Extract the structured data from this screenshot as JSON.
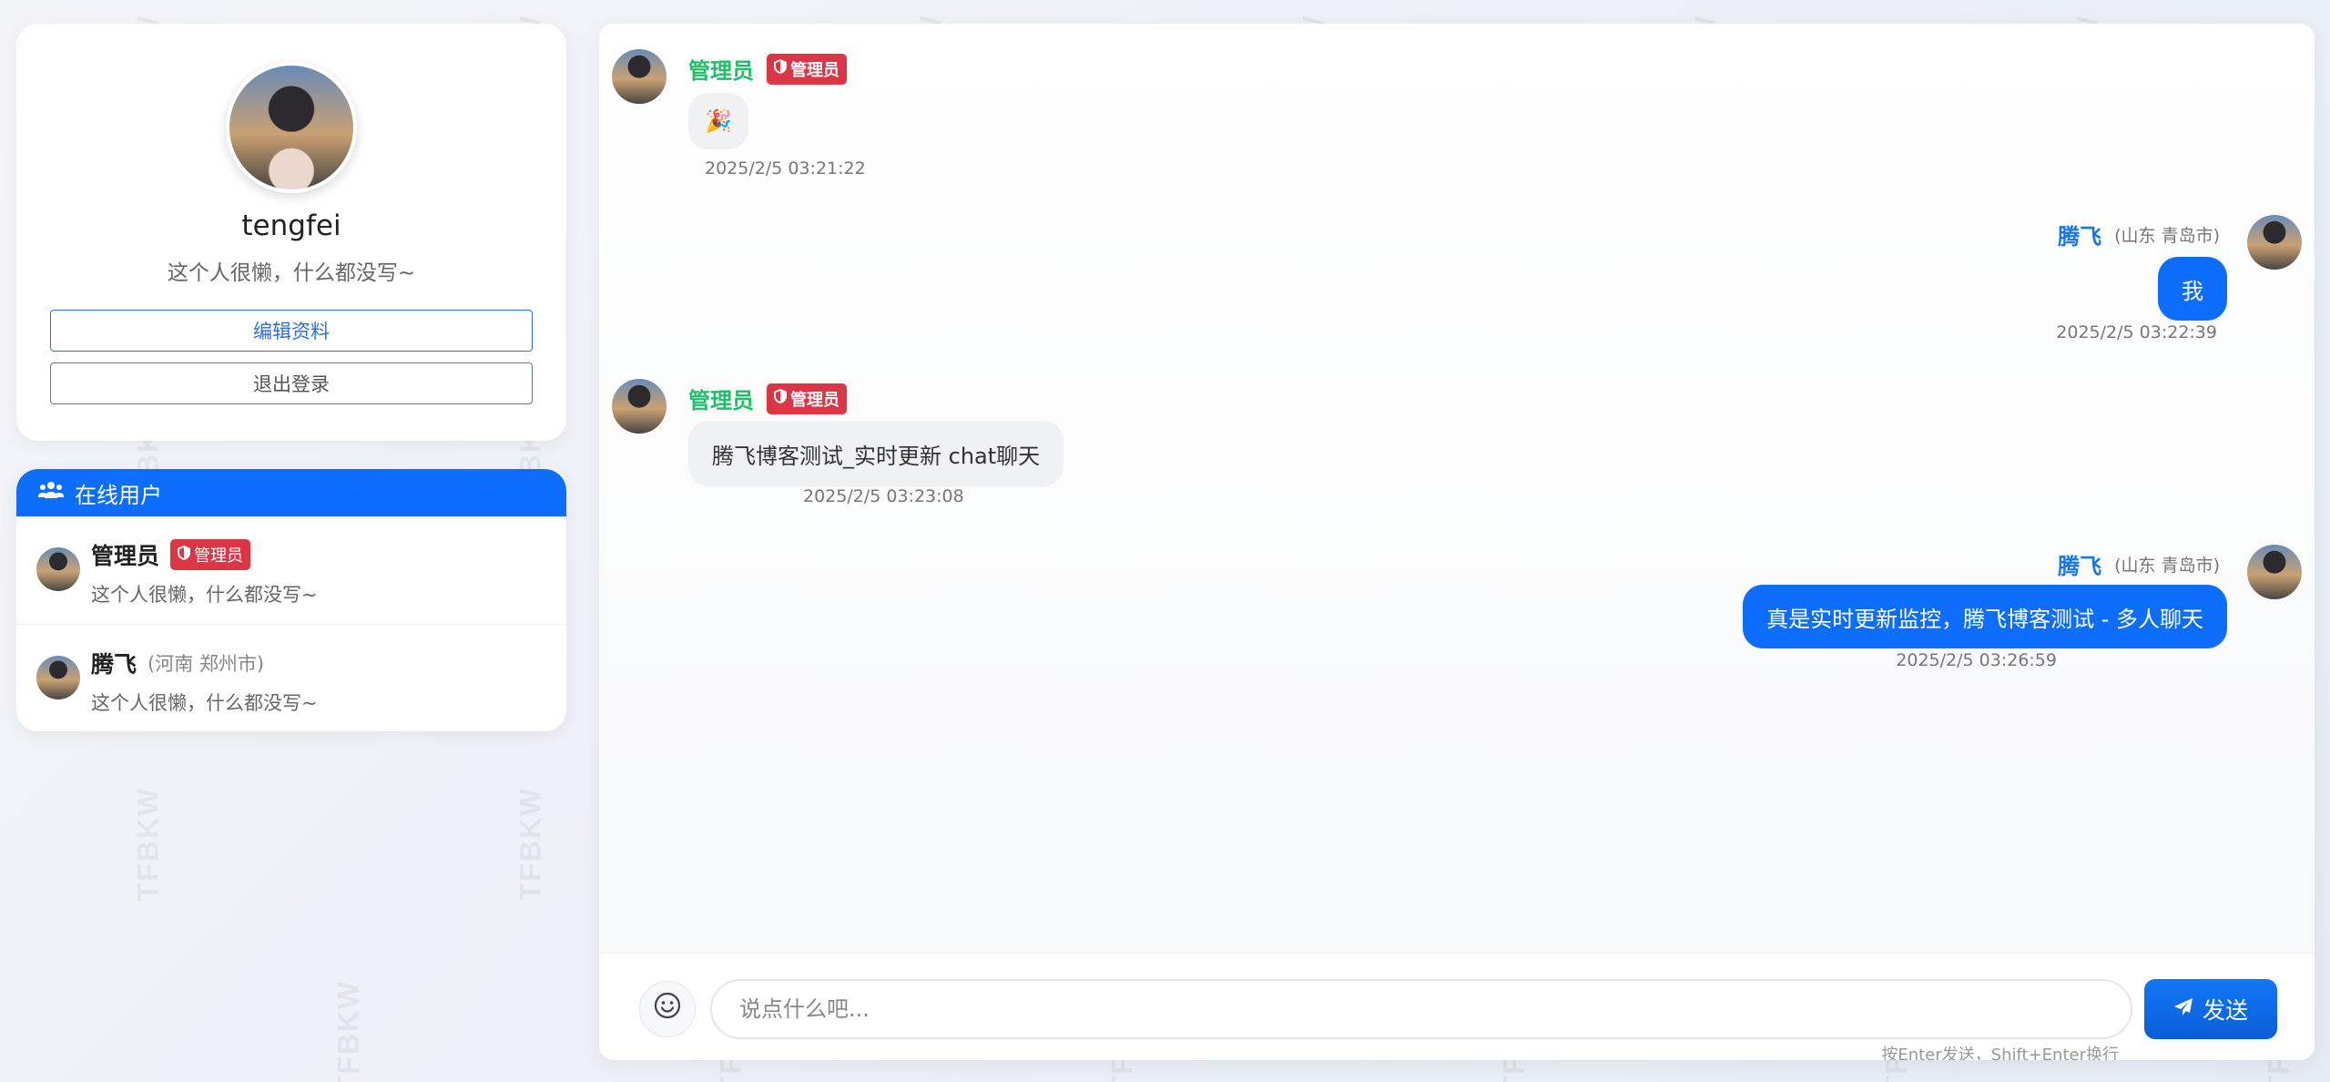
{
  "watermark_text": "TFBKW",
  "profile": {
    "name": "tengfei",
    "signature": "这个人很懒，什么都没写~",
    "edit_label": "编辑资料",
    "logout_label": "退出登录"
  },
  "online": {
    "title": "在线用户",
    "users": [
      {
        "name": "管理员",
        "badge": "管理员",
        "location": "",
        "signature": "这个人很懒，什么都没写~"
      },
      {
        "name": "腾飞",
        "badge": "",
        "location": "(河南 郑州市)",
        "signature": "这个人很懒，什么都没写~"
      }
    ]
  },
  "messages": [
    {
      "side": "left",
      "sender": "管理员",
      "badge": "管理员",
      "text": "🎉",
      "time": "2025/2/5 03:21:22"
    },
    {
      "side": "right",
      "sender": "腾飞",
      "location": "(山东 青岛市)",
      "text": "我",
      "time": "2025/2/5 03:22:39"
    },
    {
      "side": "left",
      "sender": "管理员",
      "badge": "管理员",
      "text": "腾飞博客测试_实时更新 chat聊天",
      "time": "2025/2/5 03:23:08"
    },
    {
      "side": "right",
      "sender": "腾飞",
      "location": "(山东 青岛市)",
      "text": "真是实时更新监控，腾飞博客测试 - 多人聊天",
      "time": "2025/2/5 03:26:59"
    }
  ],
  "input": {
    "placeholder": "说点什么吧...",
    "send_label": "发送",
    "hint": "按Enter发送，Shift+Enter换行"
  },
  "icons": {
    "users": "users-icon",
    "shield": "shield-icon",
    "emoji": "smile-icon",
    "send": "paper-plane-icon"
  },
  "colors": {
    "primary": "#0d6efd",
    "admin_badge": "#dc3545",
    "admin_name": "#1fbf68",
    "user_name": "#1677e5"
  }
}
